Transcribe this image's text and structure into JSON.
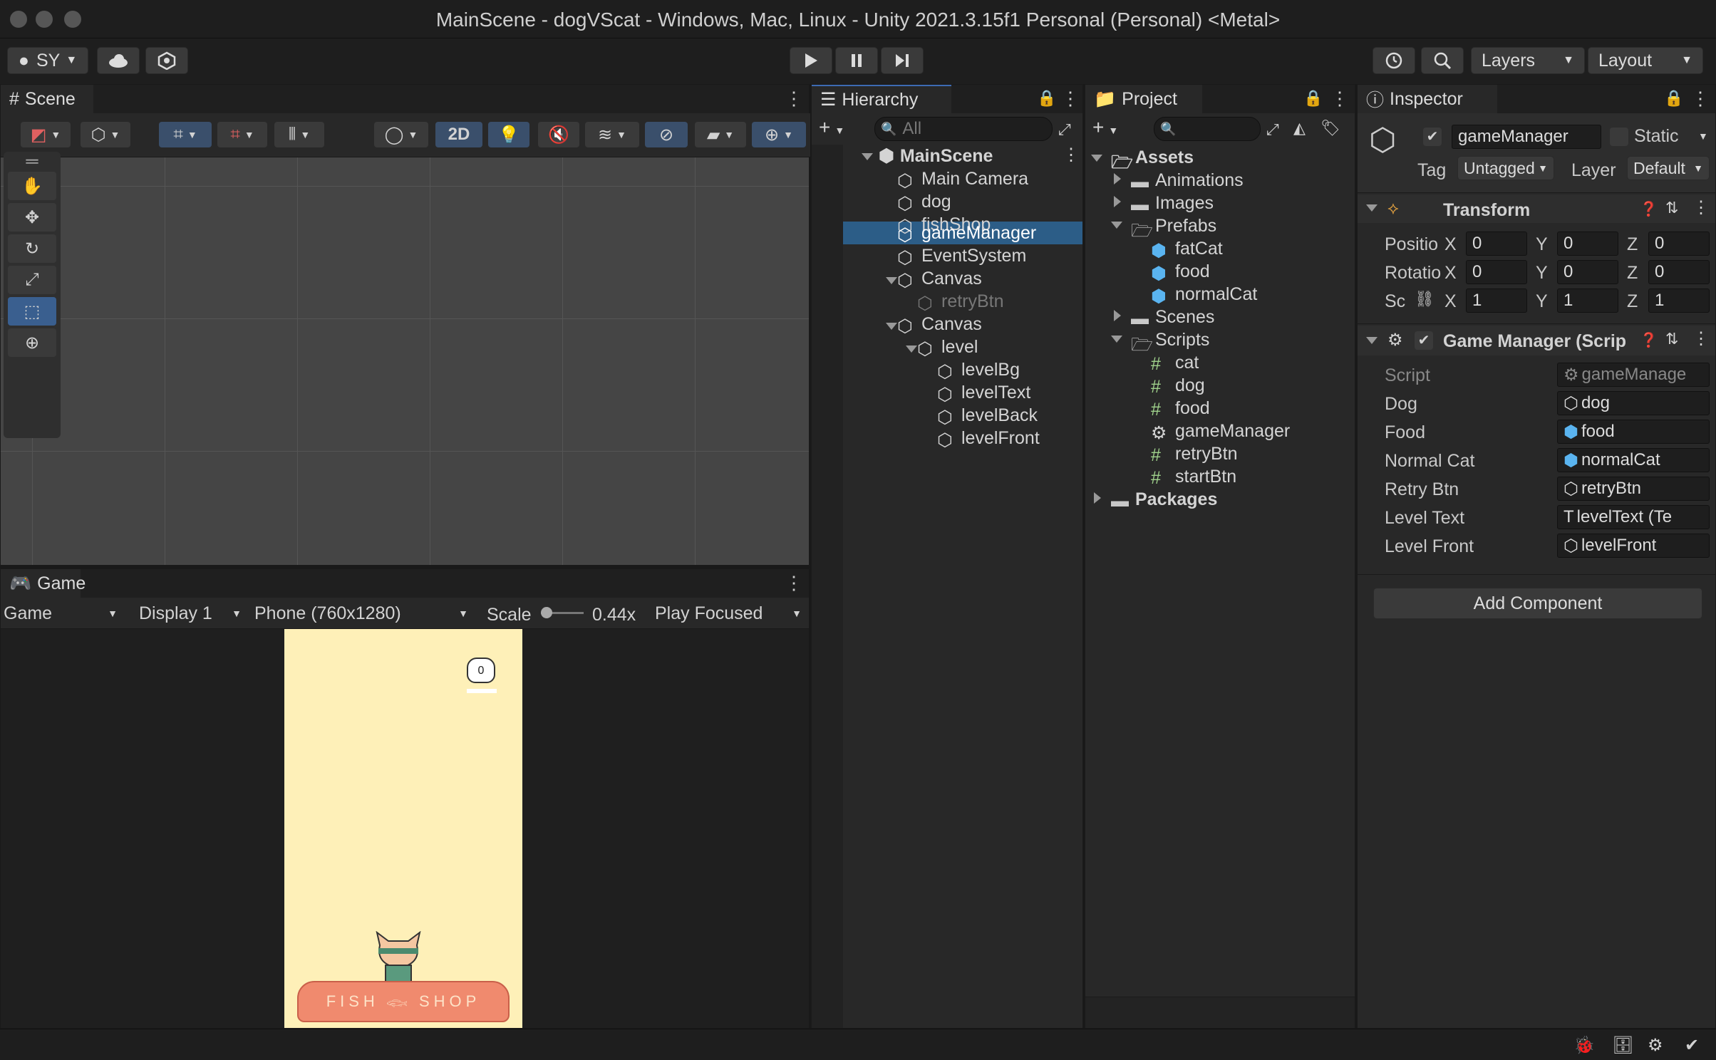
{
  "window": {
    "title": "MainScene - dogVScat - Windows, Mac, Linux - Unity 2021.3.15f1 Personal (Personal) <Metal>"
  },
  "toolbar": {
    "account": "SY",
    "layers": "Layers",
    "layout": "Layout"
  },
  "scene": {
    "tab": "Scene",
    "mode2d": "2D"
  },
  "game": {
    "tab": "Game",
    "view": "Game",
    "display": "Display 1",
    "resolution": "Phone (760x1280)",
    "scale_label": "Scale",
    "scale_value": "0.44x",
    "play_mode": "Play Focused",
    "score": "0",
    "shop_sign_left": "FISH",
    "shop_sign_right": "SHOP"
  },
  "hierarchy": {
    "tab": "Hierarchy",
    "search_placeholder": "All",
    "items": [
      "MainScene",
      "Main Camera",
      "dog",
      "fishShop",
      "gameManager",
      "EventSystem",
      "Canvas",
      "retryBtn",
      "Canvas",
      "level",
      "levelBg",
      "levelText",
      "levelBack",
      "levelFront"
    ]
  },
  "project": {
    "tab": "Project",
    "items": [
      "Assets",
      "Animations",
      "Images",
      "Prefabs",
      "fatCat",
      "food",
      "normalCat",
      "Scenes",
      "Scripts",
      "cat",
      "dog",
      "food",
      "gameManager",
      "retryBtn",
      "startBtn",
      "Packages"
    ]
  },
  "inspector": {
    "tab": "Inspector",
    "object_name": "gameManager",
    "static_label": "Static",
    "tag_label": "Tag",
    "tag_value": "Untagged",
    "layer_label": "Layer",
    "layer_value": "Default",
    "transform": {
      "title": "Transform",
      "position_label": "Positio",
      "rotation_label": "Rotatio",
      "scale_label": "Sc",
      "position": [
        "0",
        "0",
        "0"
      ],
      "rotation": [
        "0",
        "0",
        "0"
      ],
      "scale": [
        "1",
        "1",
        "1"
      ],
      "axes": [
        "X",
        "Y",
        "Z"
      ]
    },
    "script_component": {
      "title": "Game Manager (Scrip",
      "fields": [
        {
          "label": "Script",
          "value": "gameManage"
        },
        {
          "label": "Dog",
          "value": "dog"
        },
        {
          "label": "Food",
          "value": "food"
        },
        {
          "label": "Normal Cat",
          "value": "normalCat"
        },
        {
          "label": "Retry Btn",
          "value": "retryBtn"
        },
        {
          "label": "Level Text",
          "value": "levelText (Te"
        },
        {
          "label": "Level Front",
          "value": "levelFront"
        }
      ]
    },
    "add_component": "Add Component"
  },
  "colors": {
    "accent": "#3d6bb3",
    "selection": "#2c5d87",
    "game_bg": "#fef0b8",
    "shop": "#f08a6e"
  }
}
